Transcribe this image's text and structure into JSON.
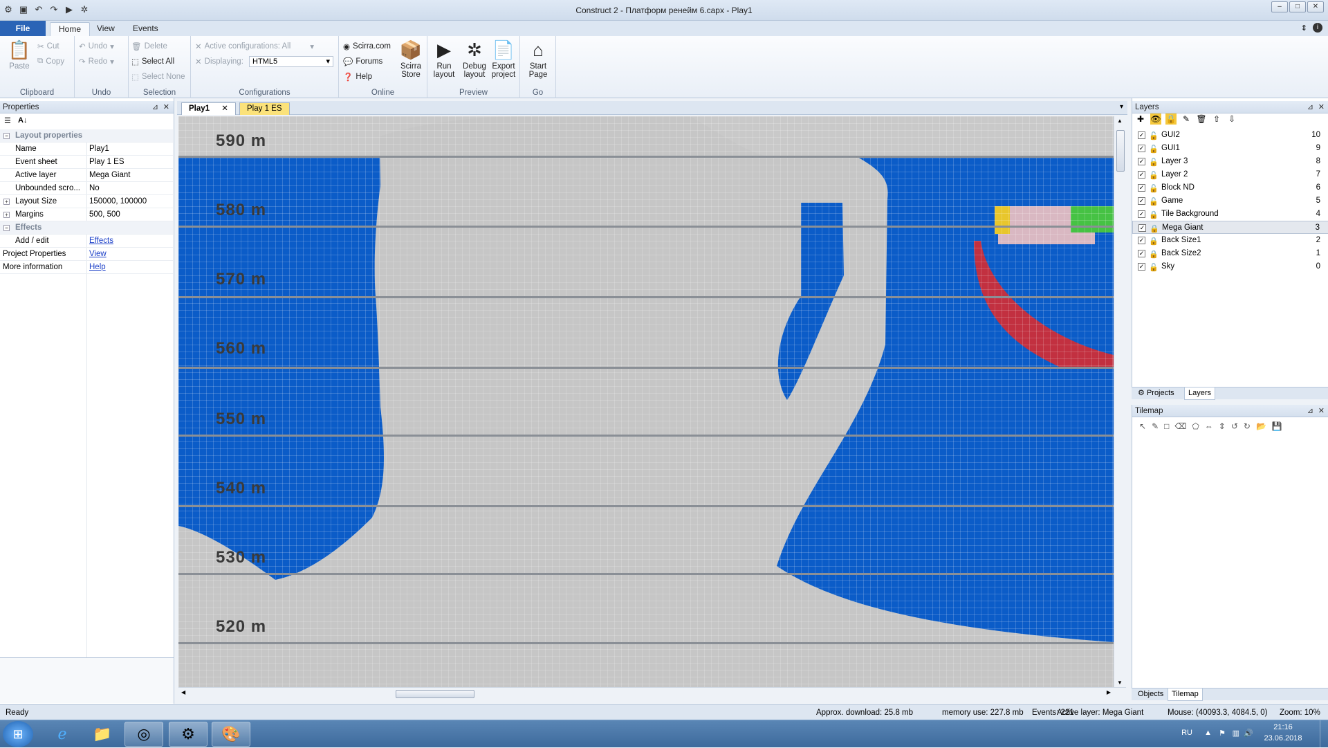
{
  "window": {
    "title": "Construct 2 - Платформ ренейм 6.capx - Play1"
  },
  "ribbon_tabs": {
    "file": "File",
    "home": "Home",
    "view": "View",
    "events": "Events"
  },
  "clipboard": {
    "paste": "Paste",
    "cut": "Cut",
    "copy": "Copy",
    "label": "Clipboard"
  },
  "undo": {
    "undo": "Undo",
    "redo": "Redo",
    "label": "Undo"
  },
  "selection": {
    "delete": "Delete",
    "select_all": "Select All",
    "select_none": "Select None",
    "label": "Selection"
  },
  "configurations": {
    "active": "Active configurations: All",
    "displaying": "Displaying:",
    "displaying_value": "HTML5",
    "label": "Configurations"
  },
  "online": {
    "scirra": "Scirra.com",
    "forums": "Forums",
    "help": "Help",
    "store_l1": "Scirra",
    "store_l2": "Store",
    "label": "Online"
  },
  "preview": {
    "run_l1": "Run",
    "run_l2": "layout",
    "debug_l1": "Debug",
    "debug_l2": "layout",
    "export_l1": "Export",
    "export_l2": "project",
    "label": "Preview"
  },
  "go": {
    "start_l1": "Start",
    "start_l2": "Page",
    "label": "Go"
  },
  "properties": {
    "title": "Properties",
    "cat_layout": "Layout properties",
    "rows": [
      {
        "k": "Name",
        "v": "Play1"
      },
      {
        "k": "Event sheet",
        "v": "Play 1 ES"
      },
      {
        "k": "Active layer",
        "v": "Mega Giant"
      },
      {
        "k": "Unbounded scro...",
        "v": "No"
      },
      {
        "k": "Layout Size",
        "v": "150000, 100000"
      },
      {
        "k": "Margins",
        "v": "500, 500"
      }
    ],
    "cat_effects": "Effects",
    "addedit": "Add / edit",
    "addedit_link": "Effects",
    "projprops": "Project Properties",
    "projprops_link": "View",
    "moreinfo": "More information",
    "moreinfo_link": "Help"
  },
  "doc_tabs": {
    "tab1": "Play1",
    "tab2": "Play 1 ES"
  },
  "canvas_labels": [
    "590 m",
    "580 m",
    "570 m",
    "560 m",
    "550 m",
    "540 m",
    "530 m",
    "520 m"
  ],
  "layers": {
    "title": "Layers",
    "items": [
      {
        "name": "GUI2",
        "num": "10"
      },
      {
        "name": "GUI1",
        "num": "9"
      },
      {
        "name": "Layer 3",
        "num": "8"
      },
      {
        "name": "Layer 2",
        "num": "7"
      },
      {
        "name": "Block ND",
        "num": "6"
      },
      {
        "name": "Game",
        "num": "5"
      },
      {
        "name": "Tile Background",
        "num": "4"
      },
      {
        "name": "Mega Giant",
        "num": "3"
      },
      {
        "name": "Back Size1",
        "num": "2"
      },
      {
        "name": "Back Size2",
        "num": "1"
      },
      {
        "name": "Sky",
        "num": "0"
      }
    ]
  },
  "panel_tabs": {
    "projects": "Projects",
    "layers": "Layers"
  },
  "tilemap": {
    "title": "Tilemap"
  },
  "bottom_tabs": {
    "objects": "Objects",
    "tilemap": "Tilemap"
  },
  "status": {
    "ready": "Ready",
    "download": "Approx. download: 25.8 mb",
    "memory": "memory use: 227.8 mb",
    "events": "Events: 221",
    "active_layer": "Active layer: Mega Giant",
    "mouse": "Mouse: (40093.3, 4084.5, 0)",
    "zoom": "Zoom: 10%"
  },
  "taskbar": {
    "lang": "RU",
    "time": "21:16",
    "date": "23.06.2018"
  },
  "colors": {
    "canvas_blue": "#0b5cc8",
    "terrain_gray": "#c6c6c6",
    "accent_red": "#c23040",
    "file_tab": "#2b64b6"
  }
}
